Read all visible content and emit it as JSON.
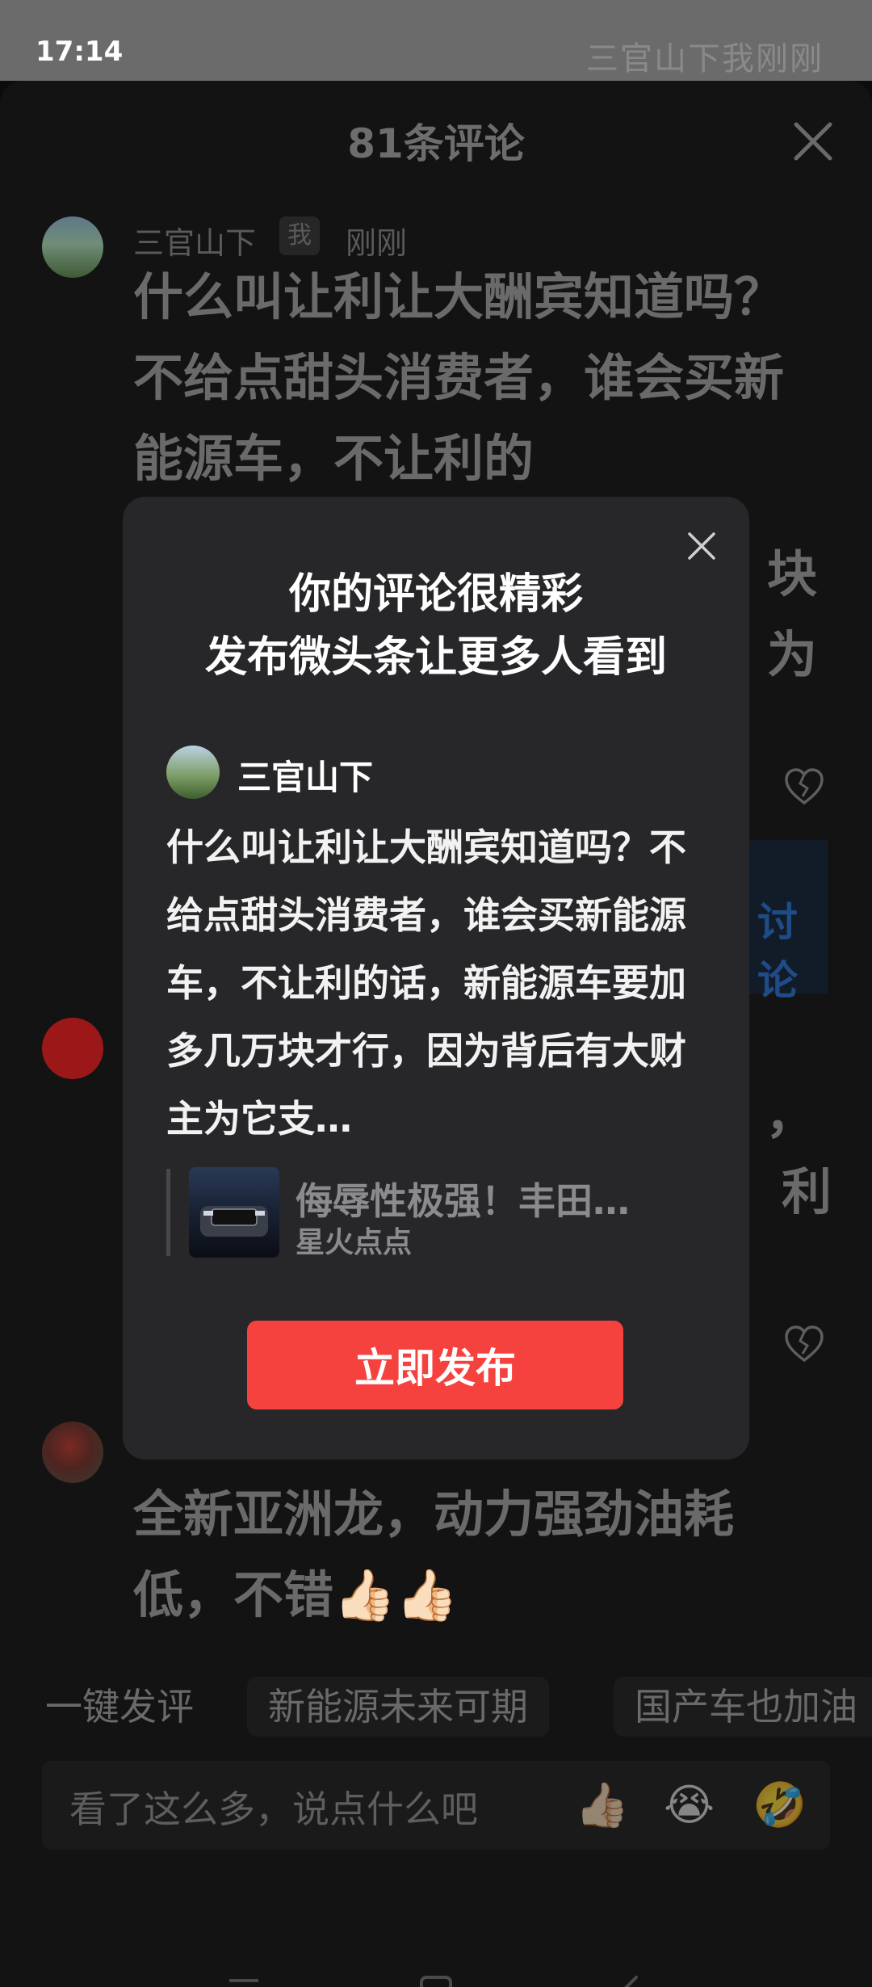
{
  "status_bar": {
    "time": "17:14",
    "ghost_text": "三官山下我刚刚"
  },
  "sheet": {
    "title": "81条评论",
    "comments": [
      {
        "name": "三官山下",
        "me_badge": "我",
        "time": "刚刚",
        "text": "什么叫让利让大酬宾知道吗？不给点甜头消费者，谁会买新能源车，不让利的",
        "frag_right_1": "块",
        "frag_right_2": "为",
        "reply_label": "讨论"
      },
      {
        "frag_1": "，",
        "frag_2": "利"
      },
      {
        "text": "全新亚洲龙，动力强劲油耗低，不错👍🏻👍🏻"
      }
    ]
  },
  "quick_replies": {
    "label": "一键发评",
    "chips": [
      "新能源未来可期",
      "国产车也加油"
    ]
  },
  "input": {
    "placeholder": "看了这么多，说点什么吧",
    "emojis": [
      "👍🏻",
      "😭",
      "🤣"
    ]
  },
  "modal": {
    "title_line1": "你的评论很精彩",
    "title_line2": "发布微头条让更多人看到",
    "author": "三官山下",
    "text": "什么叫让利让大酬宾知道吗？不给点甜头消费者，谁会买新能源车，不让利的话，新能源车要加多几万块才行，因为背后有大财主为它支…",
    "article_title": "侮辱性极强！丰田…",
    "article_source": "星火点点",
    "publish_label": "立即发布"
  }
}
